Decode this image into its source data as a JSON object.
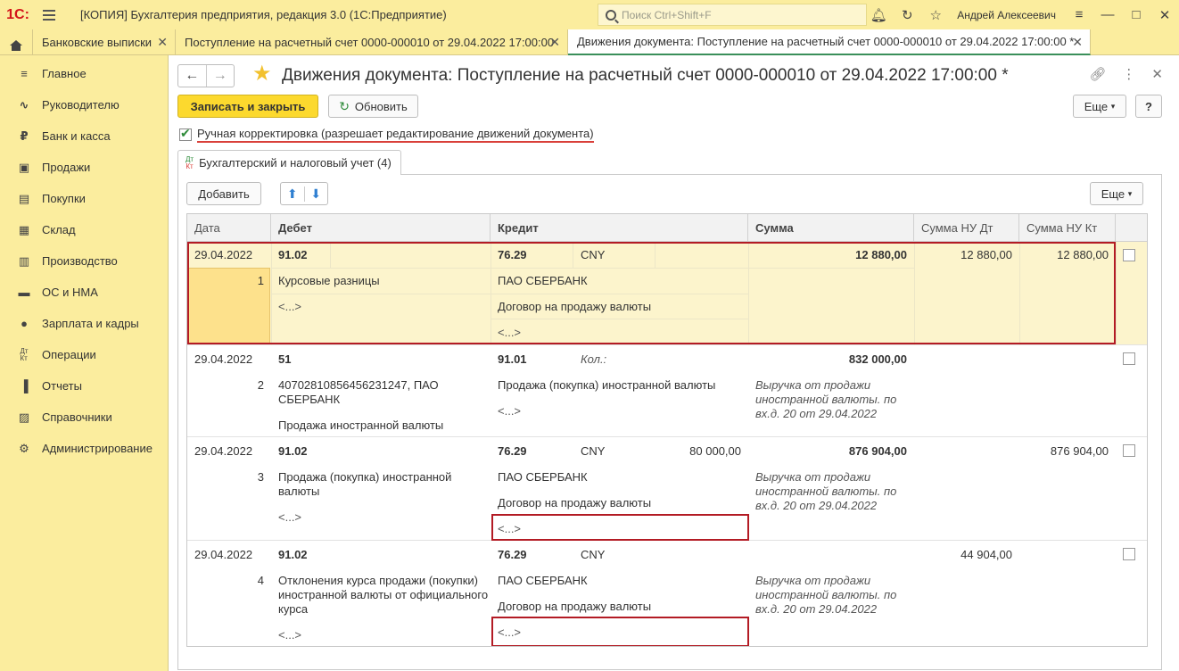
{
  "titlebar": {
    "logo": "1С:",
    "app_title": "[КОПИЯ] Бухгалтерия предприятия, редакция 3.0  (1С:Предприятие)",
    "search_placeholder": "Поиск Ctrl+Shift+F",
    "user": "Андрей Алексеевич"
  },
  "tabs": [
    {
      "label": "Банковские выписки"
    },
    {
      "label": "Поступление на расчетный счет 0000-000010 от 29.04.2022 17:00:00"
    },
    {
      "label": "Движения документа: Поступление на расчетный счет 0000-000010 от 29.04.2022 17:00:00 *"
    }
  ],
  "sidebar": {
    "items": [
      {
        "label": "Главное",
        "icon": "menu-icon"
      },
      {
        "label": "Руководителю",
        "icon": "trend-icon"
      },
      {
        "label": "Банк и касса",
        "icon": "ruble-icon"
      },
      {
        "label": "Продажи",
        "icon": "bag-icon"
      },
      {
        "label": "Покупки",
        "icon": "basket-icon"
      },
      {
        "label": "Склад",
        "icon": "warehouse-icon"
      },
      {
        "label": "Производство",
        "icon": "factory-icon"
      },
      {
        "label": "ОС и НМА",
        "icon": "truck-icon"
      },
      {
        "label": "Зарплата и кадры",
        "icon": "person-icon"
      },
      {
        "label": "Операции",
        "icon": "dtkt-icon"
      },
      {
        "label": "Отчеты",
        "icon": "chart-icon"
      },
      {
        "label": "Справочники",
        "icon": "book-icon"
      },
      {
        "label": "Администрирование",
        "icon": "gear-icon"
      }
    ]
  },
  "main": {
    "title": "Движения документа: Поступление на расчетный счет 0000-000010 от 29.04.2022 17:00:00 *",
    "save_close": "Записать и закрыть",
    "refresh": "Обновить",
    "more": "Еще",
    "help": "?",
    "manual_edit": "Ручная корректировка (разрешает редактирование движений документа)",
    "subtab": "Бухгалтерский и налоговый учет (4)",
    "subtab_icon_top": "Дт",
    "subtab_icon_bottom": "Кт",
    "add": "Добавить",
    "table_more": "Еще"
  },
  "table": {
    "headers": [
      "Дата",
      "Дебет",
      "Кредит",
      "Сумма",
      "Сумма НУ Дт",
      "Сумма НУ Кт"
    ],
    "rows": [
      {
        "date": "29.04.2022",
        "num": "1",
        "debit_account": "91.02",
        "debit_sub1": "Курсовые разницы",
        "debit_sub2": "<...>",
        "credit_account": "76.29",
        "credit_currency": "CNY",
        "credit_amount": "",
        "credit_sub1": "ПАО СБЕРБАНК",
        "credit_sub2": "Договор на продажу валюты",
        "credit_sub3": "<...>",
        "sum": "12 880,00",
        "sum_note": "",
        "nu_dt": "12 880,00",
        "nu_kt": "12 880,00"
      },
      {
        "date": "29.04.2022",
        "num": "2",
        "debit_account": "51",
        "debit_sub1": "40702810856456231247, ПАО СБЕРБАНК",
        "debit_sub2": "Продажа иностранной валюты",
        "credit_account": "91.01",
        "credit_currency": "Кол.:",
        "credit_amount": "",
        "credit_sub1": "Продажа (покупка) иностранной валюты",
        "credit_sub2": "<...>",
        "credit_sub3": "",
        "sum": "832 000,00",
        "sum_note": "Выручка от продажи иностранной валюты. по вх.д. 20 от 29.04.2022",
        "nu_dt": "",
        "nu_kt": ""
      },
      {
        "date": "29.04.2022",
        "num": "3",
        "debit_account": "91.02",
        "debit_sub1": "Продажа (покупка) иностранной валюты",
        "debit_sub2": "<...>",
        "credit_account": "76.29",
        "credit_currency": "CNY",
        "credit_amount": "80 000,00",
        "credit_sub1": "ПАО СБЕРБАНК",
        "credit_sub2": "Договор на продажу валюты",
        "credit_sub3": "<...>",
        "sum": "876 904,00",
        "sum_note": "Выручка от продажи иностранной валюты. по вх.д. 20 от 29.04.2022",
        "nu_dt": "",
        "nu_kt": "876 904,00"
      },
      {
        "date": "29.04.2022",
        "num": "4",
        "debit_account": "91.02",
        "debit_sub1": "Отклонения курса продажи (покупки) иностранной валюты от официального курса",
        "debit_sub2": "<...>",
        "credit_account": "76.29",
        "credit_currency": "CNY",
        "credit_amount": "",
        "credit_sub1": "ПАО СБЕРБАНК",
        "credit_sub2": "Договор на продажу валюты",
        "credit_sub3": "<...>",
        "sum": "",
        "sum_note": "Выручка от продажи иностранной валюты. по вх.д. 20 от 29.04.2022",
        "nu_dt": "44 904,00",
        "nu_kt": ""
      }
    ]
  }
}
